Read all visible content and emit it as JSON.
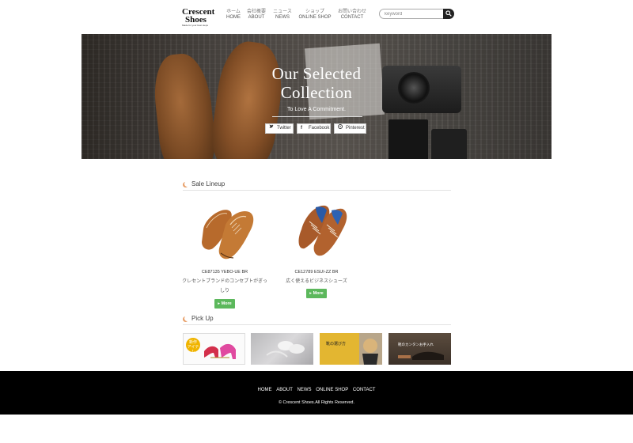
{
  "brand": {
    "name_line1": "Crescent",
    "name_line2": "Shoes",
    "tagline": "Made for your best steps"
  },
  "nav": [
    {
      "jp": "ホーム",
      "en": "HOME"
    },
    {
      "jp": "会社概要",
      "en": "ABOUT"
    },
    {
      "jp": "ニュース",
      "en": "NEWS"
    },
    {
      "jp": "ショップ",
      "en": "ONLINE SHOP"
    },
    {
      "jp": "お問い合わせ",
      "en": "CONTACT"
    }
  ],
  "search": {
    "placeholder": "keyword"
  },
  "hero": {
    "title_line1": "Our Selected",
    "title_line2": "Collection",
    "subtitle": "To Love A Commitment.",
    "share": [
      {
        "icon": "twitter-icon",
        "label": "Twitter"
      },
      {
        "icon": "facebook-icon",
        "label": "Facebook"
      },
      {
        "icon": "pinterest-icon",
        "label": "Pinterest"
      }
    ]
  },
  "sale": {
    "heading": "Sale Lineup",
    "products": [
      {
        "code": "CE87135 YEBO-UE BR",
        "desc_line1": "クレセントブランドのコンセプトがぎっ",
        "desc_line2": "しり",
        "more": "More"
      },
      {
        "code": "CE12789 ESUI-ZZ BR",
        "desc_line1": "広く使えるビジネスシューズ",
        "more": "More"
      }
    ]
  },
  "pickup": {
    "heading": "Pick Up",
    "banners": [
      {
        "badge": "新作\nアイテム"
      },
      {},
      {
        "text": "靴の選び方"
      },
      {
        "text": "靴のカンタンお手入れ"
      }
    ]
  },
  "footer": {
    "links": [
      "HOME",
      "ABOUT",
      "NEWS",
      "ONLINE SHOP",
      "CONTACT"
    ],
    "copyright": "© Crescent Shoes.All Rights Reserved."
  },
  "colors": {
    "more_button": "#5cb85c",
    "footer_bg": "#000000",
    "accent_moon": "#e8a06a"
  }
}
